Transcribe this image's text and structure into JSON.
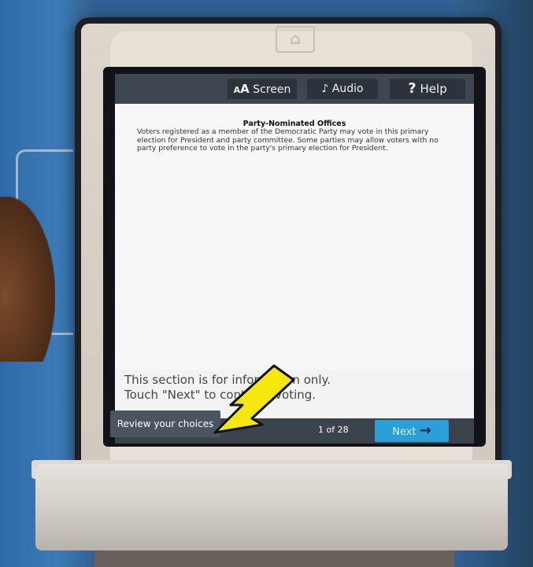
{
  "topbar": {
    "screen": {
      "label_main": "A",
      "label_rest": "Screen"
    },
    "audio": {
      "label": "Audio"
    },
    "help": {
      "label": "Help"
    }
  },
  "content": {
    "heading": "Party-Nominated Offices",
    "body": "Voters registered as a member of the Democratic Party may vote in this primary election for President and party committee.  Some parties may allow voters with no party preference to vote in the party's primary election for President."
  },
  "info": {
    "line1": "This section is for information only.",
    "line2": "Touch \"Next\" to continue voting."
  },
  "footer": {
    "review_label": "Review your choices",
    "page_count": "1 of 28",
    "next_label": "Next"
  },
  "icons": {
    "logo": "ballot-device-logo",
    "audio": "audio-icon",
    "help": "help-icon",
    "pointer": "yellow-arrow-pointer"
  },
  "colors": {
    "next": "#2a9fd8",
    "pointer": "#f5e80f"
  }
}
